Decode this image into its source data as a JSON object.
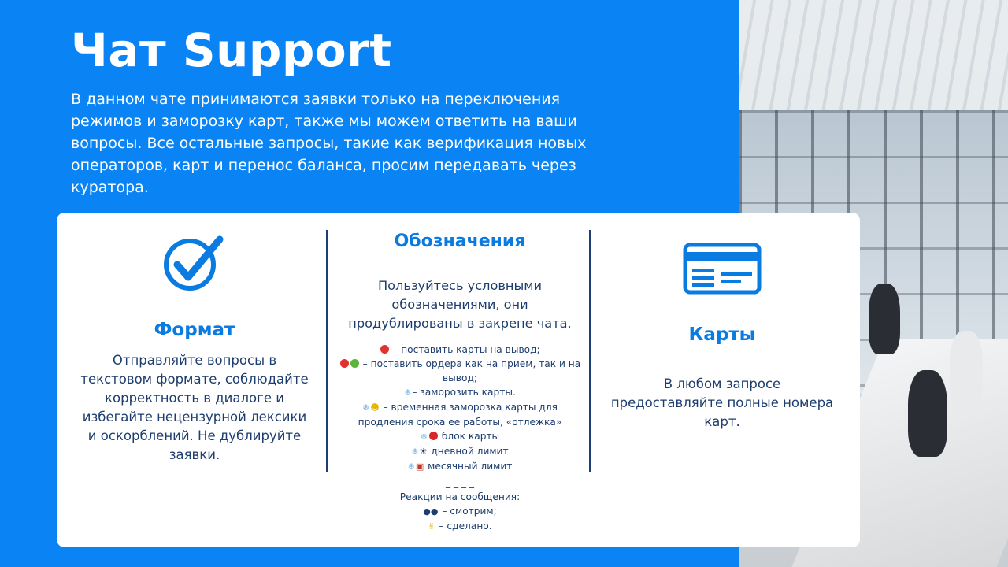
{
  "page": {
    "title": "Чат Support",
    "intro": "В данном чате принимаются заявки только на переключения режимов и заморозку карт, также мы можем ответить на ваши вопросы. Все остальные запросы, такие как верификация новых операторов, карт и перенос баланса, просим передавать через куратора."
  },
  "format": {
    "heading": "Формат",
    "text": "Отправляйте вопросы в текстовом формате, соблюдайте корректность в диалоге и избегайте нецензурной лексики и оскорблений. Не дублируйте заявки.",
    "icon": "check-circle-icon"
  },
  "legend": {
    "heading": "Обозначения",
    "intro": "Пользуйтесь условными обозначениями, они продублированы в закрепе чата.",
    "items": [
      "– поставить карты на вывод;",
      "– поставить ордера как на прием, так и на вывод;",
      "– заморозить карты.",
      "– временная заморозка карты для продления срока ее работы, «отлежка»",
      "блок карты",
      "дневной лимит",
      "месячный лимит"
    ],
    "separator": "_ _ _ _",
    "reactions_title": "Реакции на сообщения:",
    "reactions": [
      "– смотрим;",
      "– сделано."
    ]
  },
  "cards": {
    "heading": "Карты",
    "text": "В любом запросе предоставляйте полные номера карт.",
    "icon": "credit-card-icon"
  },
  "colors": {
    "background": "#0A84F5",
    "accent": "#0A7BE0",
    "text_dark": "#1d3d6e",
    "red_marker": "#E0322E",
    "green_marker": "#5DB43A"
  }
}
